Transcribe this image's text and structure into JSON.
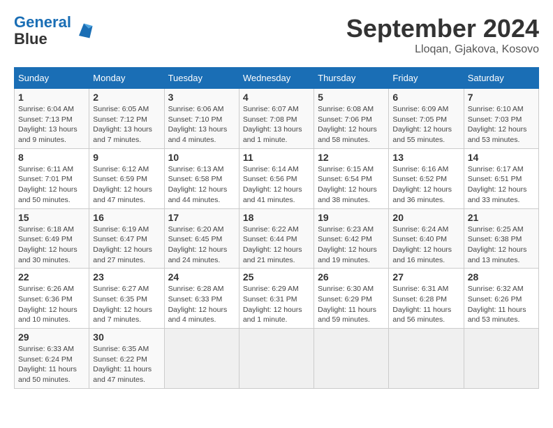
{
  "header": {
    "logo_line1": "General",
    "logo_line2": "Blue",
    "title": "September 2024",
    "subtitle": "Lloqan, Gjakova, Kosovo"
  },
  "columns": [
    "Sunday",
    "Monday",
    "Tuesday",
    "Wednesday",
    "Thursday",
    "Friday",
    "Saturday"
  ],
  "weeks": [
    [
      {
        "day": "1",
        "detail": "Sunrise: 6:04 AM\nSunset: 7:13 PM\nDaylight: 13 hours\nand 9 minutes."
      },
      {
        "day": "2",
        "detail": "Sunrise: 6:05 AM\nSunset: 7:12 PM\nDaylight: 13 hours\nand 7 minutes."
      },
      {
        "day": "3",
        "detail": "Sunrise: 6:06 AM\nSunset: 7:10 PM\nDaylight: 13 hours\nand 4 minutes."
      },
      {
        "day": "4",
        "detail": "Sunrise: 6:07 AM\nSunset: 7:08 PM\nDaylight: 13 hours\nand 1 minute."
      },
      {
        "day": "5",
        "detail": "Sunrise: 6:08 AM\nSunset: 7:06 PM\nDaylight: 12 hours\nand 58 minutes."
      },
      {
        "day": "6",
        "detail": "Sunrise: 6:09 AM\nSunset: 7:05 PM\nDaylight: 12 hours\nand 55 minutes."
      },
      {
        "day": "7",
        "detail": "Sunrise: 6:10 AM\nSunset: 7:03 PM\nDaylight: 12 hours\nand 53 minutes."
      }
    ],
    [
      {
        "day": "8",
        "detail": "Sunrise: 6:11 AM\nSunset: 7:01 PM\nDaylight: 12 hours\nand 50 minutes."
      },
      {
        "day": "9",
        "detail": "Sunrise: 6:12 AM\nSunset: 6:59 PM\nDaylight: 12 hours\nand 47 minutes."
      },
      {
        "day": "10",
        "detail": "Sunrise: 6:13 AM\nSunset: 6:58 PM\nDaylight: 12 hours\nand 44 minutes."
      },
      {
        "day": "11",
        "detail": "Sunrise: 6:14 AM\nSunset: 6:56 PM\nDaylight: 12 hours\nand 41 minutes."
      },
      {
        "day": "12",
        "detail": "Sunrise: 6:15 AM\nSunset: 6:54 PM\nDaylight: 12 hours\nand 38 minutes."
      },
      {
        "day": "13",
        "detail": "Sunrise: 6:16 AM\nSunset: 6:52 PM\nDaylight: 12 hours\nand 36 minutes."
      },
      {
        "day": "14",
        "detail": "Sunrise: 6:17 AM\nSunset: 6:51 PM\nDaylight: 12 hours\nand 33 minutes."
      }
    ],
    [
      {
        "day": "15",
        "detail": "Sunrise: 6:18 AM\nSunset: 6:49 PM\nDaylight: 12 hours\nand 30 minutes."
      },
      {
        "day": "16",
        "detail": "Sunrise: 6:19 AM\nSunset: 6:47 PM\nDaylight: 12 hours\nand 27 minutes."
      },
      {
        "day": "17",
        "detail": "Sunrise: 6:20 AM\nSunset: 6:45 PM\nDaylight: 12 hours\nand 24 minutes."
      },
      {
        "day": "18",
        "detail": "Sunrise: 6:22 AM\nSunset: 6:44 PM\nDaylight: 12 hours\nand 21 minutes."
      },
      {
        "day": "19",
        "detail": "Sunrise: 6:23 AM\nSunset: 6:42 PM\nDaylight: 12 hours\nand 19 minutes."
      },
      {
        "day": "20",
        "detail": "Sunrise: 6:24 AM\nSunset: 6:40 PM\nDaylight: 12 hours\nand 16 minutes."
      },
      {
        "day": "21",
        "detail": "Sunrise: 6:25 AM\nSunset: 6:38 PM\nDaylight: 12 hours\nand 13 minutes."
      }
    ],
    [
      {
        "day": "22",
        "detail": "Sunrise: 6:26 AM\nSunset: 6:36 PM\nDaylight: 12 hours\nand 10 minutes."
      },
      {
        "day": "23",
        "detail": "Sunrise: 6:27 AM\nSunset: 6:35 PM\nDaylight: 12 hours\nand 7 minutes."
      },
      {
        "day": "24",
        "detail": "Sunrise: 6:28 AM\nSunset: 6:33 PM\nDaylight: 12 hours\nand 4 minutes."
      },
      {
        "day": "25",
        "detail": "Sunrise: 6:29 AM\nSunset: 6:31 PM\nDaylight: 12 hours\nand 1 minute."
      },
      {
        "day": "26",
        "detail": "Sunrise: 6:30 AM\nSunset: 6:29 PM\nDaylight: 11 hours\nand 59 minutes."
      },
      {
        "day": "27",
        "detail": "Sunrise: 6:31 AM\nSunset: 6:28 PM\nDaylight: 11 hours\nand 56 minutes."
      },
      {
        "day": "28",
        "detail": "Sunrise: 6:32 AM\nSunset: 6:26 PM\nDaylight: 11 hours\nand 53 minutes."
      }
    ],
    [
      {
        "day": "29",
        "detail": "Sunrise: 6:33 AM\nSunset: 6:24 PM\nDaylight: 11 hours\nand 50 minutes."
      },
      {
        "day": "30",
        "detail": "Sunrise: 6:35 AM\nSunset: 6:22 PM\nDaylight: 11 hours\nand 47 minutes."
      },
      null,
      null,
      null,
      null,
      null
    ]
  ]
}
